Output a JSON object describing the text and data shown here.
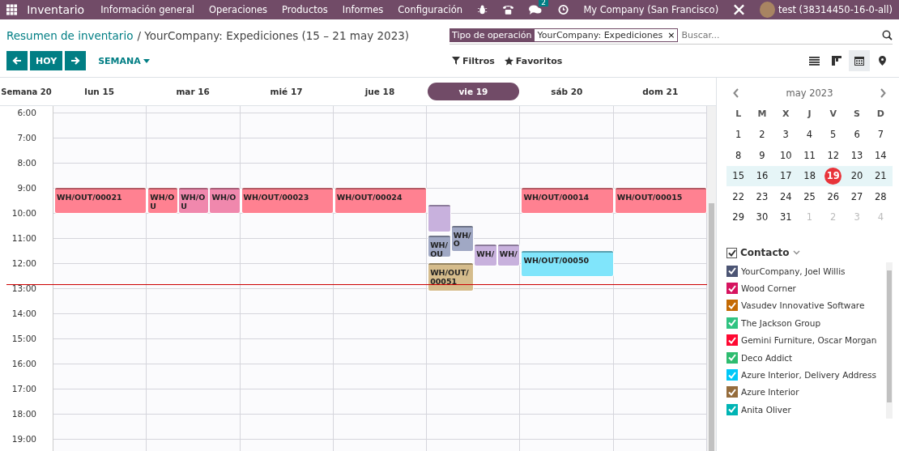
{
  "navbar": {
    "app_name": "Inventario",
    "menu": [
      "Información general",
      "Operaciones",
      "Productos",
      "Informes",
      "Configuración"
    ],
    "chat_count": "2",
    "company": "My Company (San Francisco)",
    "user": "test (38314450-16-0-all)"
  },
  "breadcrumb": {
    "parent": "Resumen de inventario",
    "current": "/ YourCompany: Expediciones (15 – 21 may 2023)"
  },
  "search": {
    "facet_label": "Tipo de operación",
    "facet_value": "YourCompany: Expediciones",
    "facet_remove": "×",
    "placeholder": "Buscar..."
  },
  "toolbar": {
    "today": "HOY",
    "scale": "SEMANA",
    "filters": "Filtros",
    "favorites": "Favoritos"
  },
  "views": [
    {
      "kind": "list",
      "selected": false
    },
    {
      "kind": "kanban",
      "selected": false
    },
    {
      "kind": "calendar",
      "selected": true
    },
    {
      "kind": "map",
      "selected": false
    }
  ],
  "calendar": {
    "week_label": "Semana 20",
    "hours": [
      "6:00",
      "7:00",
      "8:00",
      "9:00",
      "10:00",
      "11:00",
      "12:00",
      "13:00",
      "14:00",
      "15:00",
      "16:00",
      "17:00",
      "18:00",
      "19:00"
    ],
    "days": [
      {
        "label": "lun 15",
        "selected": false,
        "events": [
          {
            "title": "WH/OUT/00021",
            "kind": "morning",
            "color": "#ff8191"
          }
        ]
      },
      {
        "label": "mar 16",
        "selected": false,
        "events": [
          {
            "title": "WH/OU",
            "kind": "morning",
            "color": "#ff8191"
          },
          {
            "title": "WH/OU",
            "kind": "morning",
            "color": "#f088ad"
          },
          {
            "title": "WH/O",
            "kind": "morning",
            "color": "#f088ad"
          }
        ]
      },
      {
        "label": "mié 17",
        "selected": false,
        "events": [
          {
            "title": "WH/OUT/00023",
            "kind": "morning",
            "color": "#ff8191"
          }
        ]
      },
      {
        "label": "jue 18",
        "selected": false,
        "events": [
          {
            "title": "WH/OUT/00024",
            "kind": "morning",
            "color": "#ff8191"
          }
        ]
      },
      {
        "label": "vie 19",
        "selected": true,
        "events": [
          {
            "kind": "sliver",
            "color": "#c8b1dd"
          },
          {
            "title": "WH/O",
            "kind": "late",
            "color": "#a0a8c4"
          },
          {
            "title": "WH/OU",
            "kind": "later",
            "color": "#a0a8c4"
          },
          {
            "title": "WH/",
            "kind": "noon",
            "color": "#c8b1dd"
          },
          {
            "title": "WH/",
            "kind": "noon",
            "color": "#c8b1dd"
          },
          {
            "title": "WH/OUT/00051",
            "kind": "lunch",
            "color": "#d5bc8c"
          }
        ]
      },
      {
        "label": "sáb 20",
        "selected": false,
        "events": [
          {
            "title": "WH/OUT/00014",
            "kind": "morning",
            "color": "#ff8191"
          },
          {
            "title": "WH/OUT/00050",
            "kind": "midday",
            "color": "#80e5fb"
          }
        ]
      },
      {
        "label": "dom 21",
        "selected": false,
        "events": [
          {
            "title": "WH/OUT/00015",
            "kind": "morning",
            "color": "#ff8191"
          }
        ]
      }
    ]
  },
  "mini_calendar": {
    "month": "may 2023",
    "weekdays": [
      "L",
      "M",
      "X",
      "J",
      "V",
      "S",
      "D"
    ],
    "weeks": [
      {
        "selected": false,
        "days": [
          {
            "day": "1",
            "muted": false,
            "today": false
          },
          {
            "day": "2",
            "muted": false,
            "today": false
          },
          {
            "day": "3",
            "muted": false,
            "today": false
          },
          {
            "day": "4",
            "muted": false,
            "today": false
          },
          {
            "day": "5",
            "muted": false,
            "today": false
          },
          {
            "day": "6",
            "muted": false,
            "today": false
          },
          {
            "day": "7",
            "muted": false,
            "today": false
          }
        ]
      },
      {
        "selected": false,
        "days": [
          {
            "day": "8",
            "muted": false,
            "today": false
          },
          {
            "day": "9",
            "muted": false,
            "today": false
          },
          {
            "day": "10",
            "muted": false,
            "today": false
          },
          {
            "day": "11",
            "muted": false,
            "today": false
          },
          {
            "day": "12",
            "muted": false,
            "today": false
          },
          {
            "day": "13",
            "muted": false,
            "today": false
          },
          {
            "day": "14",
            "muted": false,
            "today": false
          }
        ]
      },
      {
        "selected": true,
        "days": [
          {
            "day": "15",
            "muted": false,
            "today": false
          },
          {
            "day": "16",
            "muted": false,
            "today": false
          },
          {
            "day": "17",
            "muted": false,
            "today": false
          },
          {
            "day": "18",
            "muted": false,
            "today": false
          },
          {
            "day": "19",
            "muted": false,
            "today": true
          },
          {
            "day": "20",
            "muted": false,
            "today": false
          },
          {
            "day": "21",
            "muted": false,
            "today": false
          }
        ]
      },
      {
        "selected": false,
        "days": [
          {
            "day": "22",
            "muted": false,
            "today": false
          },
          {
            "day": "23",
            "muted": false,
            "today": false
          },
          {
            "day": "24",
            "muted": false,
            "today": false
          },
          {
            "day": "25",
            "muted": false,
            "today": false
          },
          {
            "day": "26",
            "muted": false,
            "today": false
          },
          {
            "day": "27",
            "muted": false,
            "today": false
          },
          {
            "day": "28",
            "muted": false,
            "today": false
          }
        ]
      },
      {
        "selected": false,
        "days": [
          {
            "day": "29",
            "muted": false,
            "today": false
          },
          {
            "day": "30",
            "muted": false,
            "today": false
          },
          {
            "day": "31",
            "muted": false,
            "today": false
          },
          {
            "day": "1",
            "muted": true,
            "today": false
          },
          {
            "day": "2",
            "muted": true,
            "today": false
          },
          {
            "day": "3",
            "muted": true,
            "today": false
          },
          {
            "day": "4",
            "muted": true,
            "today": false
          }
        ]
      }
    ]
  },
  "contacts": {
    "title": "Contacto",
    "checked": true,
    "items": [
      {
        "name": "YourCompany, Joel Willis",
        "color": "#4c5574",
        "checked": true
      },
      {
        "name": "Wood Corner",
        "color": "#d6145f",
        "checked": true
      },
      {
        "name": "Vasudev Innovative Software",
        "color": "#c46a04",
        "checked": true
      },
      {
        "name": "The Jackson Group",
        "color": "#30c381",
        "checked": true
      },
      {
        "name": "Gemini Furniture, Oscar Morgan",
        "color": "#ff0932",
        "checked": true
      },
      {
        "name": "Deco Addict",
        "color": "#2ebc6f",
        "checked": true
      },
      {
        "name": "Azure Interior, Delivery Address",
        "color": "#00c8f8",
        "checked": true
      },
      {
        "name": "Azure Interior",
        "color": "#956c3c",
        "checked": true
      },
      {
        "name": "Anita Oliver",
        "color": "#00b4b4",
        "checked": true
      }
    ]
  }
}
